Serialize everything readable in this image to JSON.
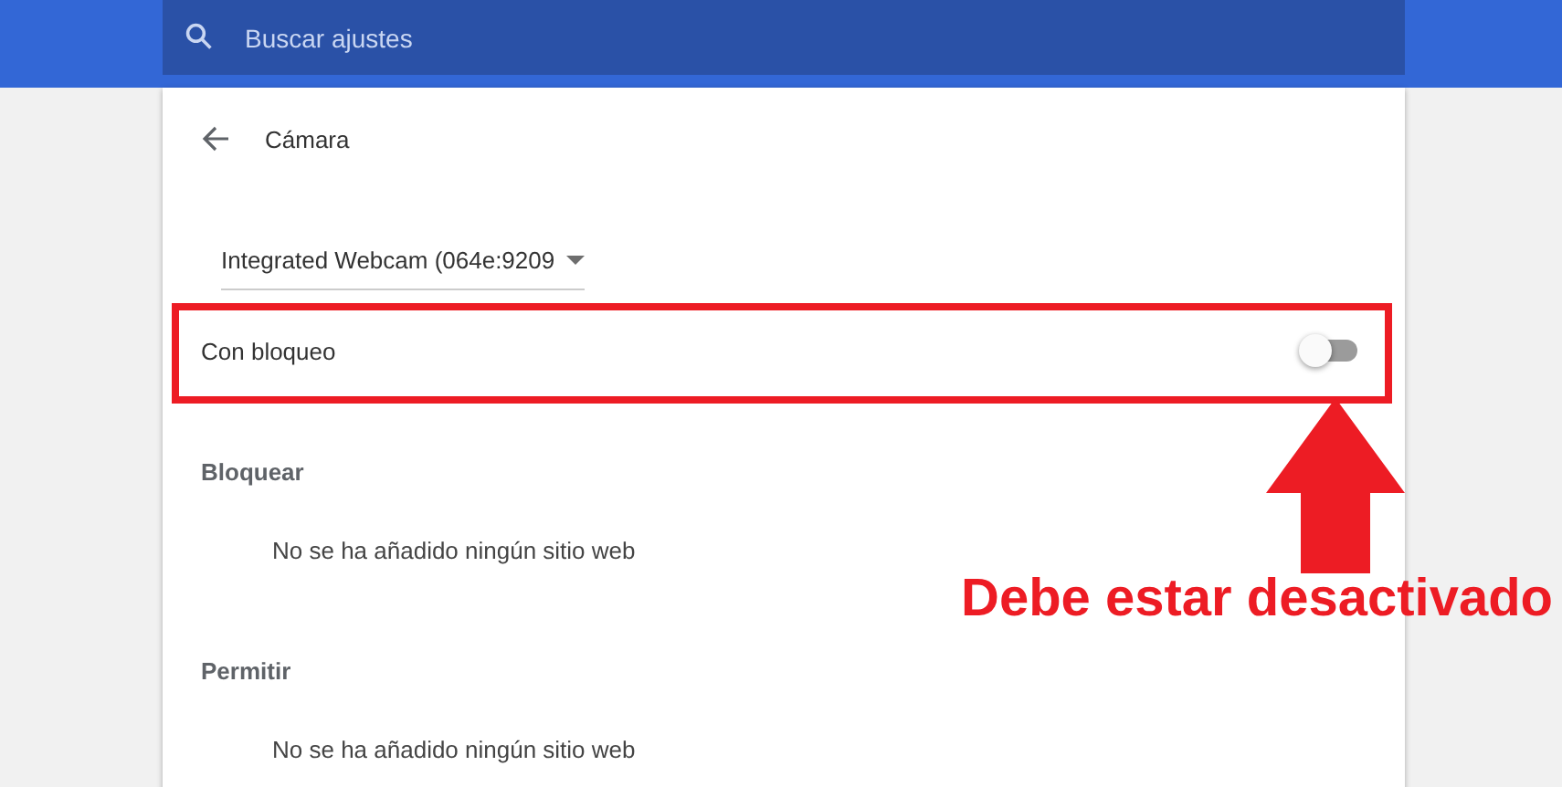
{
  "search": {
    "placeholder": "Buscar ajustes"
  },
  "page": {
    "title": "Cámara"
  },
  "camera_select": {
    "value": "Integrated Webcam (064e:9209"
  },
  "block_toggle": {
    "label": "Con bloqueo",
    "on": false
  },
  "sections": [
    {
      "title": "Bloquear",
      "empty_text": "No se ha añadido ningún sitio web"
    },
    {
      "title": "Permitir",
      "empty_text": "No se ha añadido ningún sitio web"
    }
  ],
  "annotation": {
    "text": "Debe estar desactivado"
  }
}
